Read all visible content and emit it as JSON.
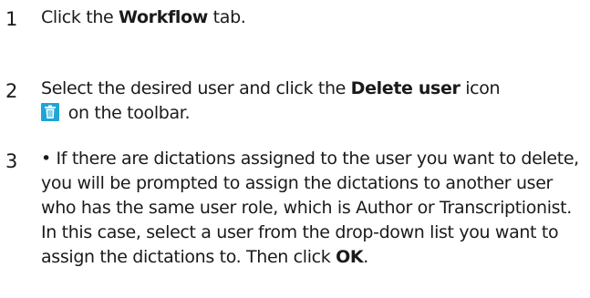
{
  "steps": [
    {
      "number": "1",
      "text_before": "Click the ",
      "bold": "Workflow",
      "text_after": " tab."
    },
    {
      "number": "2",
      "text_before": "Select the desired user and click the ",
      "bold": "Delete user",
      "text_mid": " icon",
      "icon": "trash-icon",
      "text_after": " on the toolbar."
    },
    {
      "number": "3",
      "bullet": "•",
      "text_before": " If there are dictations assigned to the user you want to delete, you will be prompted to assign the dictations to another user who has the same user role, which is Author or Transcriptionist. In this case, select a user from the drop-down list you want to assign the dictations to. Then click ",
      "bold": "OK",
      "text_after": "."
    }
  ],
  "colors": {
    "icon_background": "#1ea6d8",
    "text": "#1a1a1a"
  }
}
